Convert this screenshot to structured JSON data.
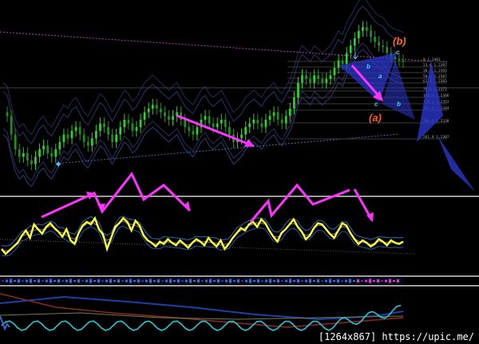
{
  "watermark": "[1264x867] https://upic.me/",
  "colors": {
    "background": "#000000",
    "bull_candle": "#2dd12d",
    "bear_candle": "#1f8f1f",
    "oscillator": "#ffff33",
    "arrow": "#ff33ff",
    "wave_b": "#ff6a1a",
    "wave_a": "#ff5a1a",
    "wave_small": "#48c8ff",
    "wave_triangle": "#2b35c8",
    "pane_separator": "#cfcfcf",
    "signal_cyan": "#29c7d6",
    "dotted_magenta": "#b040b0"
  },
  "chart_data": [
    {
      "type": "line",
      "name": "price-pane",
      "x": [
        1,
        2,
        3,
        4,
        5,
        6,
        7,
        8,
        9,
        10,
        11,
        12,
        13,
        14,
        15,
        16,
        17,
        18,
        19,
        20,
        21,
        22,
        23,
        24,
        25,
        26,
        27,
        28,
        29,
        30,
        31,
        32,
        33,
        34,
        35,
        36,
        37,
        38,
        39,
        40,
        41,
        42,
        43,
        44,
        45,
        46,
        47,
        48,
        49,
        50,
        51,
        52,
        53,
        54,
        55,
        56,
        57,
        58,
        59,
        60,
        61,
        62,
        63,
        64,
        65,
        66,
        67,
        68,
        69,
        70,
        71,
        72,
        73,
        74,
        75,
        76,
        77,
        78,
        79,
        80,
        81,
        82,
        83,
        84,
        85,
        86,
        87,
        88,
        89,
        90,
        91,
        92,
        93,
        94,
        95,
        96,
        97,
        98,
        99,
        100
      ],
      "series": [
        {
          "values": [
            1.236,
            1.2355,
            1.233,
            1.231,
            1.23,
            1.2305,
            1.2295,
            1.229,
            1.23,
            1.231,
            1.2315,
            1.2305,
            1.23,
            1.231,
            1.232,
            1.233,
            1.2325,
            1.2335,
            1.234,
            1.233,
            1.232,
            1.2315,
            1.2325,
            1.2335,
            1.2345,
            1.234,
            1.233,
            1.232,
            1.233,
            1.234,
            1.235,
            1.2345,
            1.2335,
            1.234,
            1.235,
            1.236,
            1.2365,
            1.237,
            1.2365,
            1.236,
            1.2355,
            1.235,
            1.2355,
            1.236,
            1.235,
            1.234,
            1.2335,
            1.233,
            1.234,
            1.235,
            1.2355,
            1.2345,
            1.234,
            1.2345,
            1.235,
            1.234,
            1.233,
            1.232,
            1.2325,
            1.233,
            1.234,
            1.2345,
            1.235,
            1.2345,
            1.234,
            1.235,
            1.2355,
            1.236,
            1.235,
            1.2345,
            1.2355,
            1.2365,
            1.238,
            1.24,
            1.241,
            1.2405,
            1.24,
            1.241,
            1.2405,
            1.24,
            1.2405,
            1.241,
            1.242,
            1.243,
            1.2425,
            1.244,
            1.245,
            1.246,
            1.247,
            1.2475,
            1.247,
            1.2462,
            1.2455,
            1.245,
            1.2448,
            1.244,
            1.2435,
            1.2432,
            1.243,
            1.2428
          ]
        }
      ],
      "fib_labels": [
        "0 1.2401",
        "23.6 1.2397",
        "38.2 1.2392",
        "50.0 1.2387",
        "61.8 1.2383",
        "76.4 1.2375",
        "100.0 1.2366",
        "138.2 1.2353",
        "161.8 1.2344",
        "200.0 1.2330",
        "261.8 1.2307"
      ],
      "wave_labels": [
        "(b)",
        "(a)",
        "c",
        "b",
        "a",
        "c",
        "b"
      ],
      "grid": false
    },
    {
      "type": "line",
      "name": "oscillator-pane",
      "x": [
        1,
        2,
        3,
        4,
        5,
        6,
        7,
        8,
        9,
        10,
        11,
        12,
        13,
        14,
        15,
        16,
        17,
        18,
        19,
        20,
        21,
        22,
        23,
        24,
        25,
        26,
        27,
        28,
        29,
        30,
        31,
        32,
        33,
        34,
        35,
        36,
        37,
        38,
        39,
        40,
        41,
        42,
        43,
        44,
        45,
        46,
        47,
        48,
        49,
        50,
        51,
        52,
        53,
        54,
        55,
        56,
        57,
        58,
        59,
        60,
        61,
        62,
        63,
        64,
        65,
        66,
        67,
        68,
        69,
        70,
        71,
        72,
        73,
        74,
        75,
        76,
        77,
        78,
        79,
        80,
        81,
        82,
        83,
        84,
        85,
        86,
        87,
        88,
        89,
        90,
        91,
        92,
        93,
        94,
        95,
        96,
        97,
        98,
        99,
        100
      ],
      "series": [
        {
          "values": [
            30,
            22,
            28,
            34,
            40,
            52,
            60,
            48,
            70,
            62,
            55,
            66,
            72,
            64,
            58,
            50,
            62,
            44,
            38,
            56,
            68,
            74,
            70,
            80,
            62,
            54,
            30,
            48,
            66,
            72,
            80,
            74,
            60,
            76,
            68,
            52,
            44,
            40,
            34,
            42,
            38,
            46,
            40,
            36,
            44,
            38,
            32,
            40,
            46,
            42,
            36,
            48,
            40,
            34,
            44,
            30,
            38,
            48,
            56,
            64,
            60,
            70,
            74,
            66,
            78,
            72,
            60,
            50,
            42,
            56,
            62,
            70,
            78,
            66,
            58,
            46,
            52,
            64,
            72,
            70,
            62,
            54,
            48,
            60,
            72,
            68,
            56,
            46,
            38,
            44,
            40,
            34,
            38,
            46,
            42,
            36,
            44,
            40,
            38,
            42
          ]
        }
      ],
      "ylim": [
        0,
        100
      ],
      "grid": false
    }
  ]
}
